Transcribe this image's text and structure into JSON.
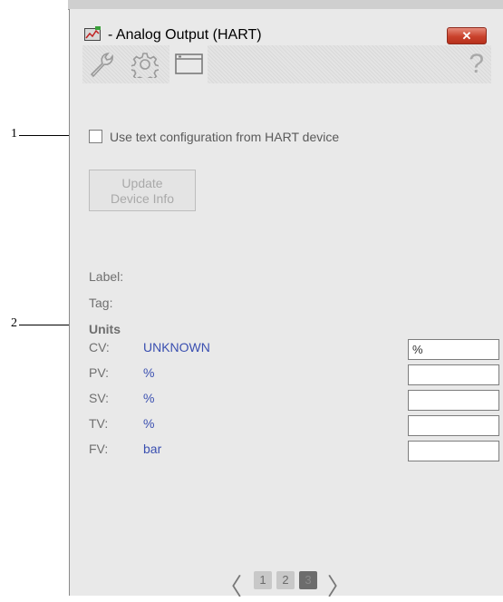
{
  "callouts": {
    "one": "1",
    "two": "2"
  },
  "window": {
    "title": "- Analog Output (HART)",
    "close_label": "✕",
    "help_label": "?"
  },
  "tabs": [
    {
      "icon": "wrench-icon"
    },
    {
      "icon": "gear-icon"
    },
    {
      "icon": "window-icon",
      "active": true
    }
  ],
  "config": {
    "checkbox_label": "Use text configuration from HART device",
    "update_button": "Update Device Info",
    "label_label": "Label:",
    "tag_label": "Tag:"
  },
  "units": {
    "heading": "Units",
    "rows": [
      {
        "name": "CV:",
        "value": "UNKNOWN",
        "input": "%"
      },
      {
        "name": "PV:",
        "value": "%",
        "input": ""
      },
      {
        "name": "SV:",
        "value": "%",
        "input": ""
      },
      {
        "name": "TV:",
        "value": "%",
        "input": ""
      },
      {
        "name": "FV:",
        "value": "bar",
        "input": ""
      }
    ]
  },
  "pager": {
    "prev": "〈",
    "next": "〉",
    "pages": [
      "1",
      "2",
      "3"
    ],
    "current": "3"
  },
  "colors": {
    "unit_value": "#3a4fb0",
    "close": "#c9422c"
  }
}
